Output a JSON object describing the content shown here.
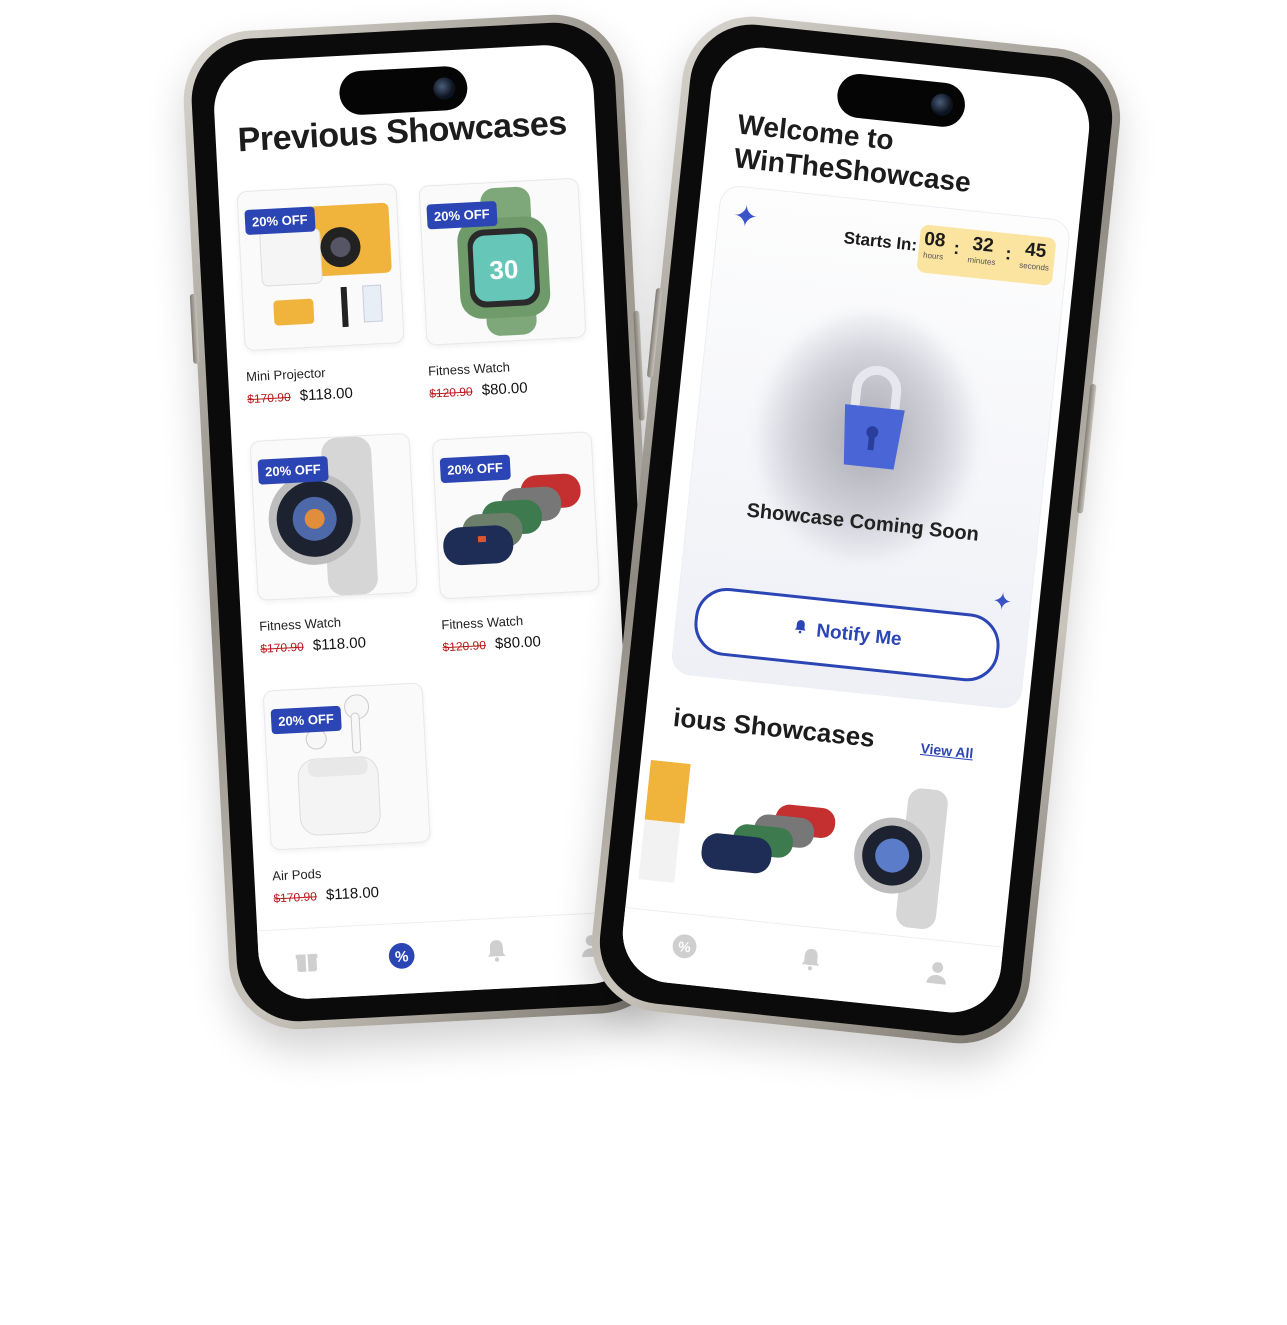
{
  "phone1": {
    "title": "Previous Showcases",
    "products": [
      {
        "badge": "20% OFF",
        "name": "Mini Projector",
        "old_price": "$170.90",
        "new_price": "$118.00",
        "image": "projector"
      },
      {
        "badge": "20% OFF",
        "name": "Fitness Watch",
        "old_price": "$120.90",
        "new_price": "$80.00",
        "image": "green-watch"
      },
      {
        "badge": "20% OFF",
        "name": "Fitness Watch",
        "old_price": "$170.90",
        "new_price": "$118.00",
        "image": "silver-watch"
      },
      {
        "badge": "20% OFF",
        "name": "Fitness Watch",
        "old_price": "$120.90",
        "new_price": "$80.00",
        "image": "speakers"
      },
      {
        "badge": "20% OFF",
        "name": "Air Pods",
        "old_price": "$170.90",
        "new_price": "$118.00",
        "image": "airpods"
      }
    ],
    "tabs": [
      {
        "icon": "gift-icon",
        "active": false
      },
      {
        "icon": "discount-icon",
        "active": true
      },
      {
        "icon": "bell-icon",
        "active": false
      },
      {
        "icon": "profile-icon",
        "active": false
      }
    ]
  },
  "phone2": {
    "welcome_line1": "Welcome to",
    "welcome_line2": "WinTheShowcase",
    "starts_in": "Starts In:",
    "timer": {
      "hours": "08",
      "hours_label": "hours",
      "minutes": "32",
      "minutes_label": "minutes",
      "seconds": "45",
      "seconds_label": "seconds"
    },
    "coming_soon": "Showcase Coming Soon",
    "notify_label": "Notify Me",
    "section_title": "ious Showcases",
    "view_all": "View All"
  },
  "colors": {
    "accent": "#2b45b5",
    "timer_bg": "#fbe3a0",
    "price_old": "#b81a1a"
  }
}
